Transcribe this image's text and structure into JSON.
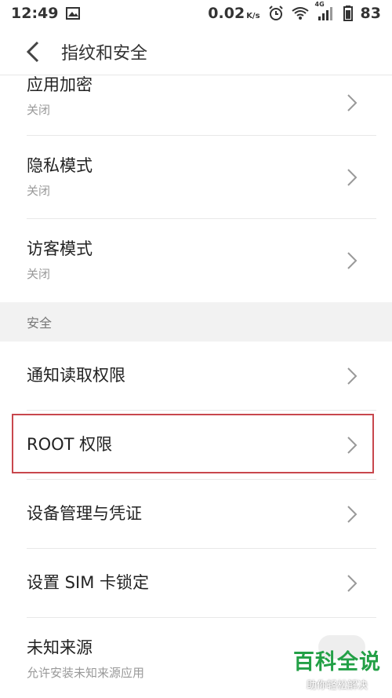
{
  "status_bar": {
    "time": "12:49",
    "speed_value": "0.02",
    "speed_unit": "K/s",
    "network": "4G",
    "battery": "83"
  },
  "header": {
    "title": "指纹和安全"
  },
  "rows_top": [
    {
      "title": "应用加密",
      "subtitle": "关闭"
    },
    {
      "title": "隐私模式",
      "subtitle": "关闭"
    },
    {
      "title": "访客模式",
      "subtitle": "关闭"
    }
  ],
  "section": {
    "title": "安全"
  },
  "rows_security": [
    {
      "title": "通知读取权限"
    },
    {
      "title": "ROOT 权限"
    },
    {
      "title": "设备管理与凭证"
    },
    {
      "title": "设置 SIM 卡锁定"
    }
  ],
  "row_unknown": {
    "title": "未知来源",
    "subtitle": "允许安装未知来源应用"
  },
  "watermark": {
    "title": "百科全说",
    "subtitle": "助你轻松解决"
  },
  "colors": {
    "highlight": "#c8474d",
    "watermark_green": "#23a046"
  }
}
